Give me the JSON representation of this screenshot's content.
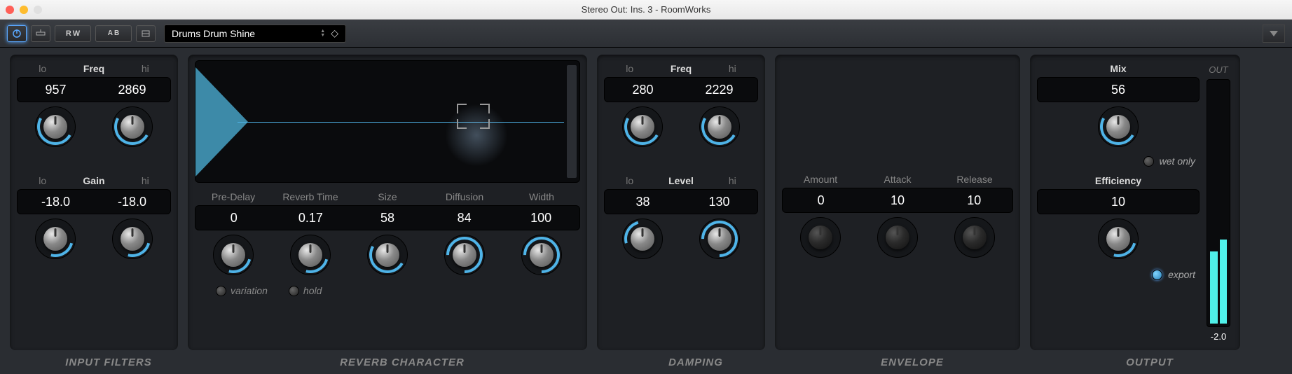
{
  "window": {
    "title": "Stereo Out: Ins. 3 - RoomWorks"
  },
  "toolbar": {
    "preset": "Drums Drum Shine"
  },
  "input_filters": {
    "label_lo": "lo",
    "label_mid": "Freq",
    "label_hi": "hi",
    "freq_lo": "957",
    "freq_hi": "2869",
    "gain_label_mid": "Gain",
    "gain_lo": "-18.0",
    "gain_hi": "-18.0"
  },
  "reverb": {
    "labels": {
      "predelay": "Pre-Delay",
      "time": "Reverb Time",
      "size": "Size",
      "diffusion": "Diffusion",
      "width": "Width"
    },
    "values": {
      "predelay": "0",
      "time": "0.17",
      "size": "58",
      "diffusion": "84",
      "width": "100"
    },
    "toggles": {
      "variation": "variation",
      "hold": "hold"
    }
  },
  "damping": {
    "label_lo": "lo",
    "label_mid_freq": "Freq",
    "label_hi": "hi",
    "freq_lo": "280",
    "freq_hi": "2229",
    "label_mid_level": "Level",
    "level_lo": "38",
    "level_hi": "130"
  },
  "envelope": {
    "labels": {
      "amount": "Amount",
      "attack": "Attack",
      "release": "Release"
    },
    "values": {
      "amount": "0",
      "attack": "10",
      "release": "10"
    }
  },
  "output": {
    "mix_label": "Mix",
    "mix_value": "56",
    "wet_only": "wet only",
    "eff_label": "Efficiency",
    "eff_value": "10",
    "export": "export",
    "out_label": "OUT",
    "meter_db": "-2.0"
  },
  "footer": {
    "input": "INPUT FILTERS",
    "reverb": "REVERB CHARACTER",
    "damping": "DAMPING",
    "envelope": "ENVELOPE",
    "output": "OUTPUT"
  }
}
